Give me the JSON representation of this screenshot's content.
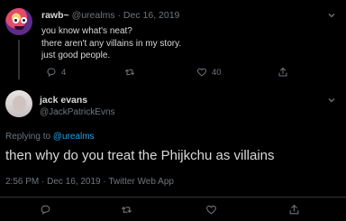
{
  "parent_tweet": {
    "display_name": "rawb~",
    "handle": "@urealms",
    "separator": " · ",
    "date": "Dec 16, 2019",
    "lines": [
      "you know what's neat?",
      "there aren't any villains in my story.",
      "just good people."
    ],
    "reply_count": "4",
    "like_count": "40"
  },
  "main_tweet": {
    "display_name": "jack evans",
    "handle": "@JackPatrickEvns",
    "replying_to_label": "Replying to ",
    "replying_to_handle": "@urealms",
    "text": "then why do you treat the Phijkchu as villains",
    "meta": "2:56 PM · Dec 16, 2019 · Twitter Web App"
  },
  "colors": {
    "background": "#000000",
    "text_primary": "#d9d9d9",
    "text_secondary": "#6e767d",
    "link": "#1da1f2",
    "divider": "#2f3336"
  },
  "icons": {
    "reply": "reply-icon",
    "retweet": "retweet-icon",
    "like": "like-icon",
    "share": "share-icon",
    "more": "caret-down-icon"
  }
}
